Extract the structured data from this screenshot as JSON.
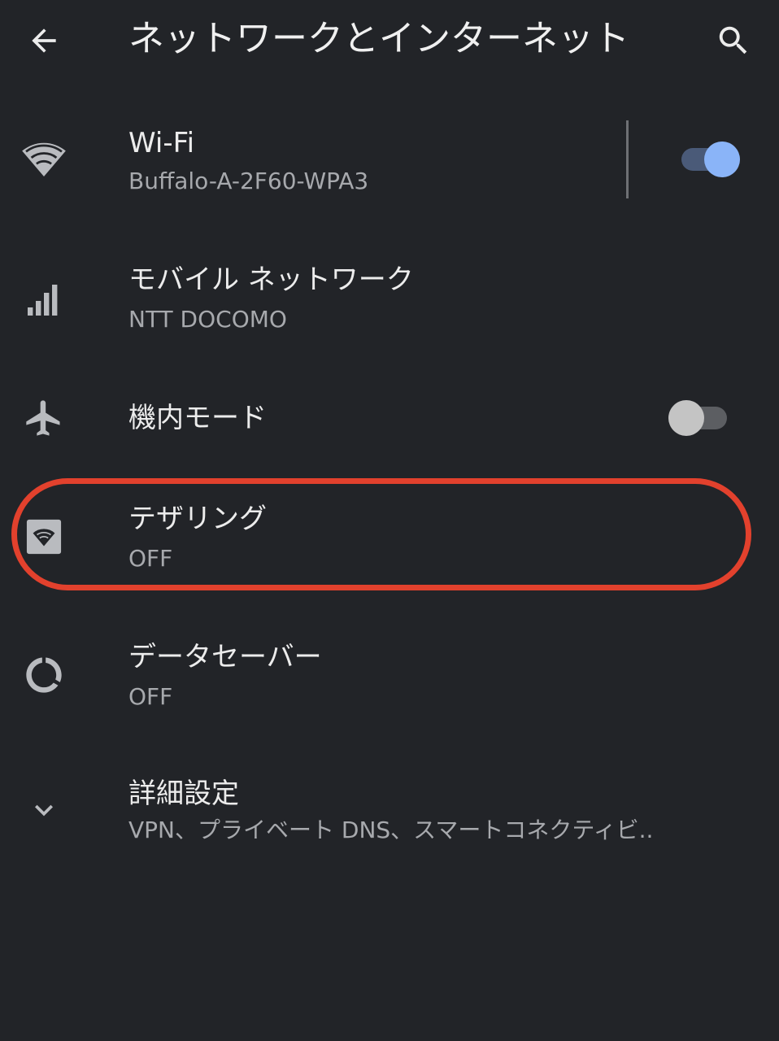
{
  "header": {
    "title": "ネットワークとインターネット",
    "back_icon": "arrow-left-icon",
    "search_icon": "search-icon"
  },
  "items": [
    {
      "title": "Wi-Fi",
      "subtitle": "Buffalo-A-2F60-WPA3",
      "icon": "wifi-icon",
      "toggle": true
    },
    {
      "title": "モバイル ネットワーク",
      "subtitle": "NTT DOCOMO",
      "icon": "signal-bars-icon"
    },
    {
      "title": "機内モード",
      "icon": "airplane-icon",
      "toggle": false
    },
    {
      "title": "テザリング",
      "subtitle": "OFF",
      "icon": "hotspot-icon",
      "highlighted": true
    },
    {
      "title": "データセーバー",
      "subtitle": "OFF",
      "icon": "data-saver-icon"
    },
    {
      "title": "詳細設定",
      "subtitle": "VPN、プライベート DNS、スマートコネクティビ..",
      "icon": "chevron-down-icon"
    }
  ],
  "colors": {
    "background": "#222428",
    "toggle_on_thumb": "#8ab4f8",
    "toggle_on_track": "#4a5a78",
    "toggle_off_thumb": "#c4c4c4",
    "toggle_off_track": "#5c5e62",
    "highlight_ring": "#e2412d"
  }
}
